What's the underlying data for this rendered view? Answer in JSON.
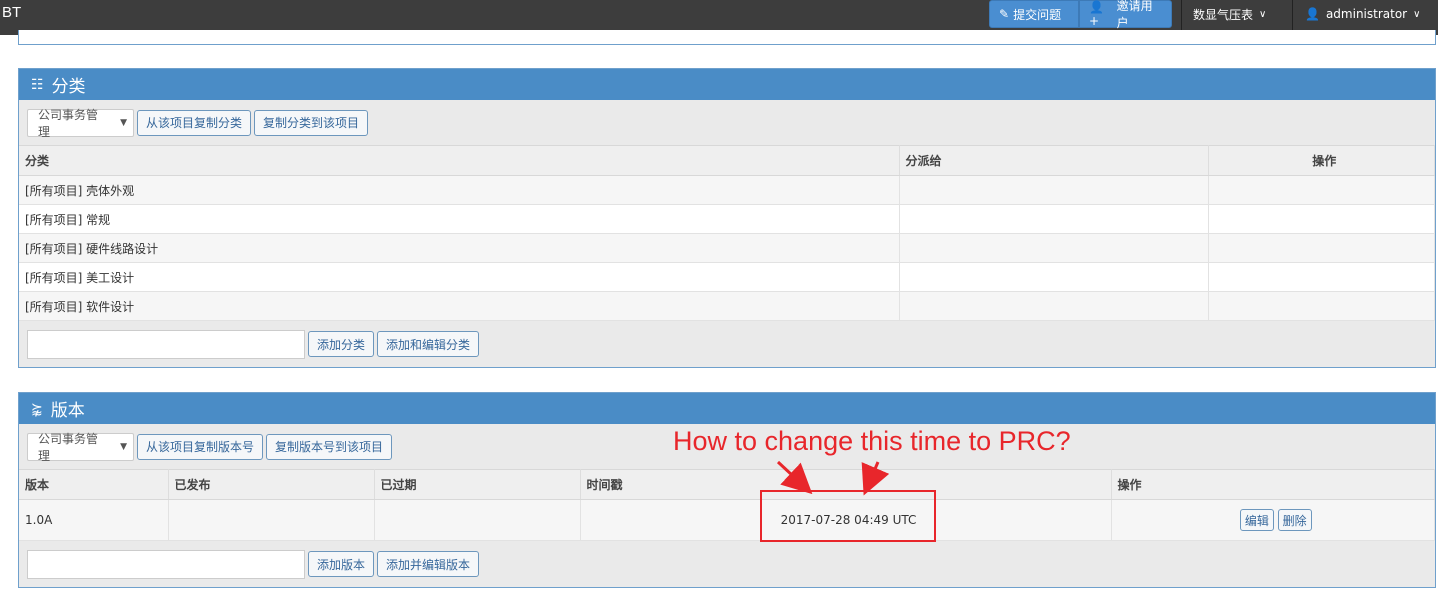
{
  "navbar": {
    "brand": "BT",
    "report_issue": "提交问题",
    "invite_users": "邀请用户",
    "project_selector": "数显气压表",
    "user_menu": "administrator"
  },
  "categories": {
    "title": "分类",
    "project_select": "公司事务管理",
    "copy_from": "从该项目复制分类",
    "copy_to": "复制分类到该项目",
    "columns": [
      "分类",
      "分派给",
      "操作"
    ],
    "rows": [
      {
        "name": "[所有项目] 壳体外观",
        "assigned": "",
        "actions": ""
      },
      {
        "name": "[所有项目] 常规",
        "assigned": "",
        "actions": ""
      },
      {
        "name": "[所有项目] 硬件线路设计",
        "assigned": "",
        "actions": ""
      },
      {
        "name": "[所有项目] 美工设计",
        "assigned": "",
        "actions": ""
      },
      {
        "name": "[所有项目] 软件设计",
        "assigned": "",
        "actions": ""
      }
    ],
    "input_value": "",
    "add": "添加分类",
    "add_edit": "添加和编辑分类"
  },
  "versions": {
    "title": "版本",
    "project_select": "公司事务管理",
    "copy_from": "从该项目复制版本号",
    "copy_to": "复制版本号到该项目",
    "columns": [
      "版本",
      "已发布",
      "已过期",
      "时间戳",
      "操作"
    ],
    "rows": [
      {
        "version": "1.0A",
        "released": "",
        "obsolete": "",
        "timestamp": "2017-07-28 04:49 UTC",
        "edit": "编辑",
        "delete": "删除"
      }
    ],
    "input_value": "",
    "add": "添加版本",
    "add_edit": "添加并编辑版本"
  },
  "annotation": {
    "text": "How to change this time to PRC?",
    "color": "#e8262b"
  }
}
